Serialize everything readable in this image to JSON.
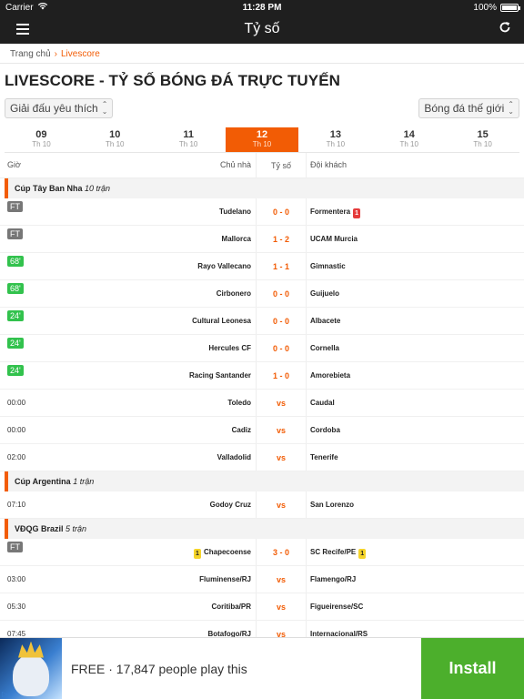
{
  "status_bar": {
    "carrier": "Carrier",
    "time": "11:28 PM",
    "battery": "100%"
  },
  "nav": {
    "title": "Tỷ số"
  },
  "breadcrumb": {
    "home": "Trang chủ",
    "sep": "›",
    "current": "Livescore"
  },
  "page_title": "LIVESCORE - TỶ SỐ BÓNG ĐÁ TRỰC TUYẾN",
  "filters": {
    "left": "Giải đấu yêu thích",
    "right": "Bóng đá thế giới"
  },
  "dates": [
    {
      "day": "09",
      "month": "Th 10",
      "active": false
    },
    {
      "day": "10",
      "month": "Th 10",
      "active": false
    },
    {
      "day": "11",
      "month": "Th 10",
      "active": false
    },
    {
      "day": "12",
      "month": "Th 10",
      "active": true
    },
    {
      "day": "13",
      "month": "Th 10",
      "active": false
    },
    {
      "day": "14",
      "month": "Th 10",
      "active": false
    },
    {
      "day": "15",
      "month": "Th 10",
      "active": false
    }
  ],
  "columns": {
    "time": "Giờ",
    "home": "Chủ nhà",
    "score": "Tỷ số",
    "away": "Đội khách"
  },
  "leagues": [
    {
      "name": "Cúp Tây Ban Nha",
      "count": "10 trận",
      "matches": [
        {
          "status": "FT",
          "status_type": "ft",
          "home": "Tudelano",
          "score": "0 - 0",
          "away": "Formentera",
          "away_card": "1",
          "away_card_color": "red"
        },
        {
          "status": "FT",
          "status_type": "ft",
          "home": "Mallorca",
          "score": "1 - 2",
          "away": "UCAM Murcia"
        },
        {
          "status": "68'",
          "status_type": "live",
          "home": "Rayo Vallecano",
          "score": "1 - 1",
          "away": "Gimnastic"
        },
        {
          "status": "68'",
          "status_type": "live",
          "home": "Cirbonero",
          "score": "0 - 0",
          "away": "Guijuelo"
        },
        {
          "status": "24'",
          "status_type": "live",
          "home": "Cultural Leonesa",
          "score": "0 - 0",
          "away": "Albacete"
        },
        {
          "status": "24'",
          "status_type": "live",
          "home": "Hercules CF",
          "score": "0 - 0",
          "away": "Cornella"
        },
        {
          "status": "24'",
          "status_type": "live",
          "home": "Racing Santander",
          "score": "1 - 0",
          "away": "Amorebieta"
        },
        {
          "status": "00:00",
          "status_type": "time",
          "home": "Toledo",
          "score": "vs",
          "away": "Caudal"
        },
        {
          "status": "00:00",
          "status_type": "time",
          "home": "Cadiz",
          "score": "vs",
          "away": "Cordoba"
        },
        {
          "status": "02:00",
          "status_type": "time",
          "home": "Valladolid",
          "score": "vs",
          "away": "Tenerife"
        }
      ]
    },
    {
      "name": "Cúp Argentina",
      "count": "1 trận",
      "matches": [
        {
          "status": "07:10",
          "status_type": "time",
          "home": "Godoy Cruz",
          "score": "vs",
          "away": "San Lorenzo"
        }
      ]
    },
    {
      "name": "VĐQG Brazil",
      "count": "5 trận",
      "matches": [
        {
          "status": "FT",
          "status_type": "ft",
          "home": "Chapecoense",
          "home_card": "1",
          "home_card_color": "yellow",
          "score": "3 - 0",
          "away": "SC Recife/PE",
          "away_card": "1",
          "away_card_color": "yellow"
        },
        {
          "status": "03:00",
          "status_type": "time",
          "home": "Fluminense/RJ",
          "score": "vs",
          "away": "Flamengo/RJ"
        },
        {
          "status": "05:30",
          "status_type": "time",
          "home": "Coritiba/PR",
          "score": "vs",
          "away": "Figueirense/SC"
        },
        {
          "status": "07:45",
          "status_type": "time",
          "home": "Botafogo/RJ",
          "score": "vs",
          "away": "Internacional/RS"
        }
      ]
    }
  ],
  "ad": {
    "text": "FREE · 17,847 people play this",
    "button": "Install"
  },
  "colors": {
    "accent": "#f25c05",
    "live": "#32c24d",
    "ft": "#777777",
    "install": "#4caf2c"
  }
}
